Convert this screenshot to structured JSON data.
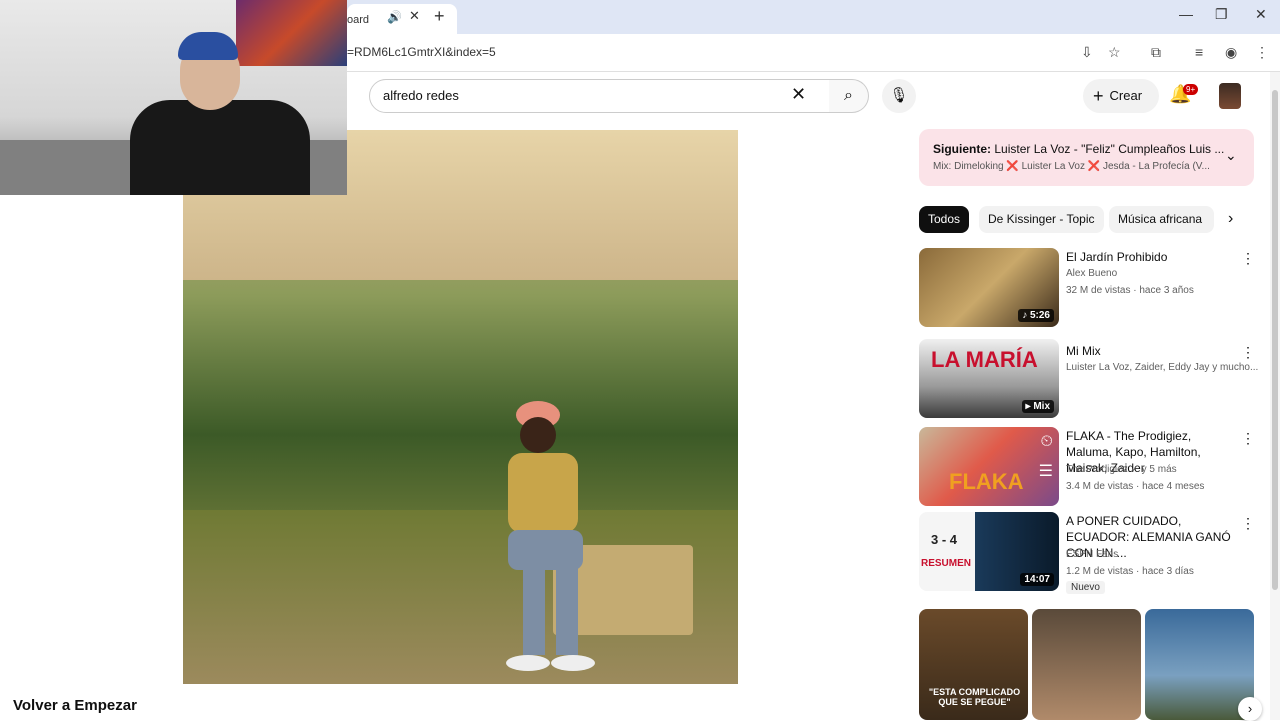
{
  "browser": {
    "tab_title": "oard",
    "url": "=RDM6Lc1GmtrXI&index=5",
    "new_tab": "+",
    "min": "—",
    "max": "❐",
    "close": "✕"
  },
  "header": {
    "search_value": "alfredo redes",
    "create_label": "Crear",
    "notification_badge": "9+"
  },
  "player": {
    "channel_title": "Volver a Empezar"
  },
  "up_next": {
    "prefix": "Siguiente:",
    "title": "Luister La Voz - \"Feliz\" Cumpleaños Luis ...",
    "mix_line": "Mix: Dimeloking ❌ Luister La Voz ❌ Jesda - La Profecía (V..."
  },
  "chips": [
    "Todos",
    "De Kissinger - Topic",
    "Música africana"
  ],
  "videos": [
    {
      "title": "El Jardín Prohibido",
      "channel": "Alex Bueno",
      "meta": "32 M de vistas · hace 3 años",
      "duration": "♪ 5:26"
    },
    {
      "title": "Mi Mix",
      "channel": "Luister La Voz, Zaider, Eddy Jay y mucho...",
      "meta": "",
      "duration": "▸ Mix"
    },
    {
      "title": "FLAKA - The Prodigiez, Maluma, Kapo, Hamilton, Maisak, Zaider",
      "channel": "The Prodigiez ✓ y 5 más",
      "meta": "3.4 M de vistas · hace 4 meses",
      "duration": ""
    },
    {
      "title": "A PONER CUIDADO, ECUADOR: ALEMANIA GANÓ CON UN ...",
      "channel": "ESPN Fans",
      "meta": "1.2 M de vistas · hace 3 días",
      "duration": "14:07",
      "badge": "Nuevo"
    }
  ],
  "thumb_text": {
    "la_maria": "LA MARÍA",
    "flaka": "FLAKA",
    "score": "3 - 4",
    "resumen": "RESUMEN",
    "short1": "\"ESTA COMPLICADO QUE SE PEGUE\""
  }
}
